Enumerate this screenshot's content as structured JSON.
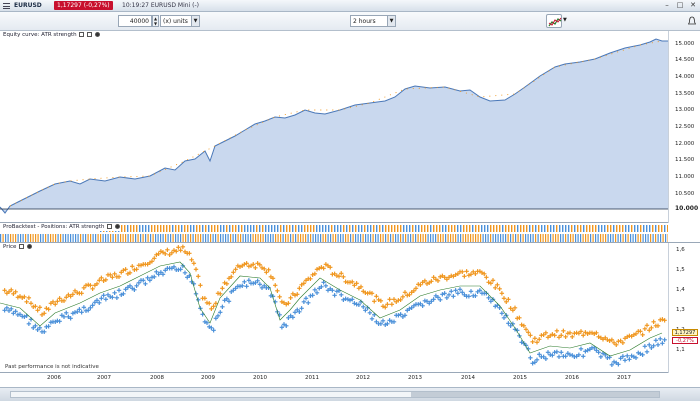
{
  "titlebar": {
    "symbol": "EURUSD",
    "price_change": "1,17297 (-0,27%)",
    "meta": "10:19:27 EURUSD Mini (-)"
  },
  "toolbar": {
    "quantity": "40000",
    "units_label": "(x) units",
    "timeframe": "2 hours"
  },
  "equity_panel": {
    "title": "Equity curve: ATR strength",
    "y_ticks": [
      "15.000",
      "14.500",
      "14.000",
      "13.500",
      "13.000",
      "12.500",
      "12.000",
      "11.500",
      "11.000",
      "10.500",
      "10.000"
    ]
  },
  "positions_panel": {
    "title": "ProBacktest - Positions: ATR strength"
  },
  "price_panel": {
    "title": "Price",
    "y_ticks": [
      "1,6",
      "1,5",
      "1,4",
      "1,3",
      "1,2",
      "1,1"
    ],
    "last_price": "1,17297",
    "last_change": "-0,27%",
    "disclaimer": "Past performance is not indicative"
  },
  "x_axis": {
    "years": [
      "2006",
      "2007",
      "2008",
      "2009",
      "2010",
      "2011",
      "2012",
      "2013",
      "2014",
      "2015",
      "2016",
      "2017"
    ]
  },
  "colors": {
    "equity_fill": "#c9d8ee",
    "equity_line": "#4a78b8",
    "buy": "#4a90d9",
    "sell": "#f0961e",
    "badge": "#c8102e"
  }
}
